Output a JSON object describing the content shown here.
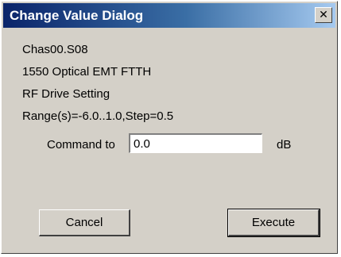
{
  "window": {
    "title": "Change Value Dialog",
    "close_glyph": "✕"
  },
  "info": {
    "chassis": "Chas00.S08",
    "module": "1550 Optical EMT FTTH",
    "setting": "RF Drive Setting",
    "range": "Range(s)=-6.0..1.0,Step=0.5"
  },
  "command": {
    "label": "Command to",
    "value": "0.0",
    "unit": "dB"
  },
  "buttons": {
    "cancel": "Cancel",
    "execute": "Execute"
  }
}
